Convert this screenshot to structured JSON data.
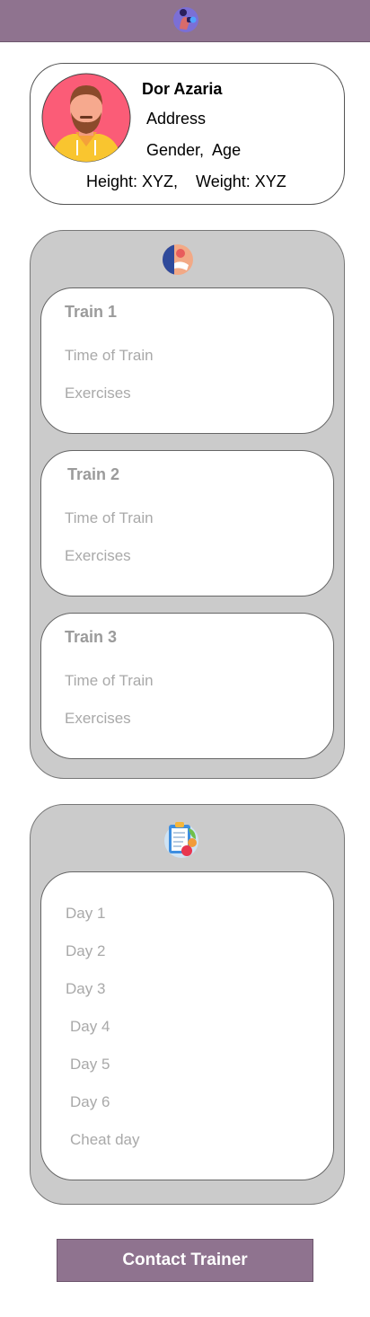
{
  "header": {
    "logo_icon": "fitness-logo-icon"
  },
  "profile": {
    "name": "Dor Azaria",
    "address": "Address",
    "gender_age": "Gender,  Age",
    "measurements": "Height: XYZ,    Weight: XYZ",
    "avatar_icon": "bearded-man-avatar"
  },
  "trainings": {
    "icon": "workout-icon",
    "items": [
      {
        "title": "Train 1",
        "time": "Time of Train",
        "exercises": "Exercises"
      },
      {
        "title": "Train 2",
        "time": "Time of Train",
        "exercises": "Exercises"
      },
      {
        "title": "Train 3",
        "time": "Time of Train",
        "exercises": "Exercises"
      }
    ]
  },
  "diet": {
    "icon": "meal-plan-clipboard-icon",
    "days": [
      "Day 1",
      "Day 2",
      "Day 3",
      "Day 4",
      "Day 5",
      "Day 6",
      "Cheat day"
    ]
  },
  "contact_button": {
    "label": "Contact Trainer"
  },
  "colors": {
    "accent": "#8f738f",
    "panel": "#cbcbcb",
    "muted_text": "#a9a9a9"
  }
}
